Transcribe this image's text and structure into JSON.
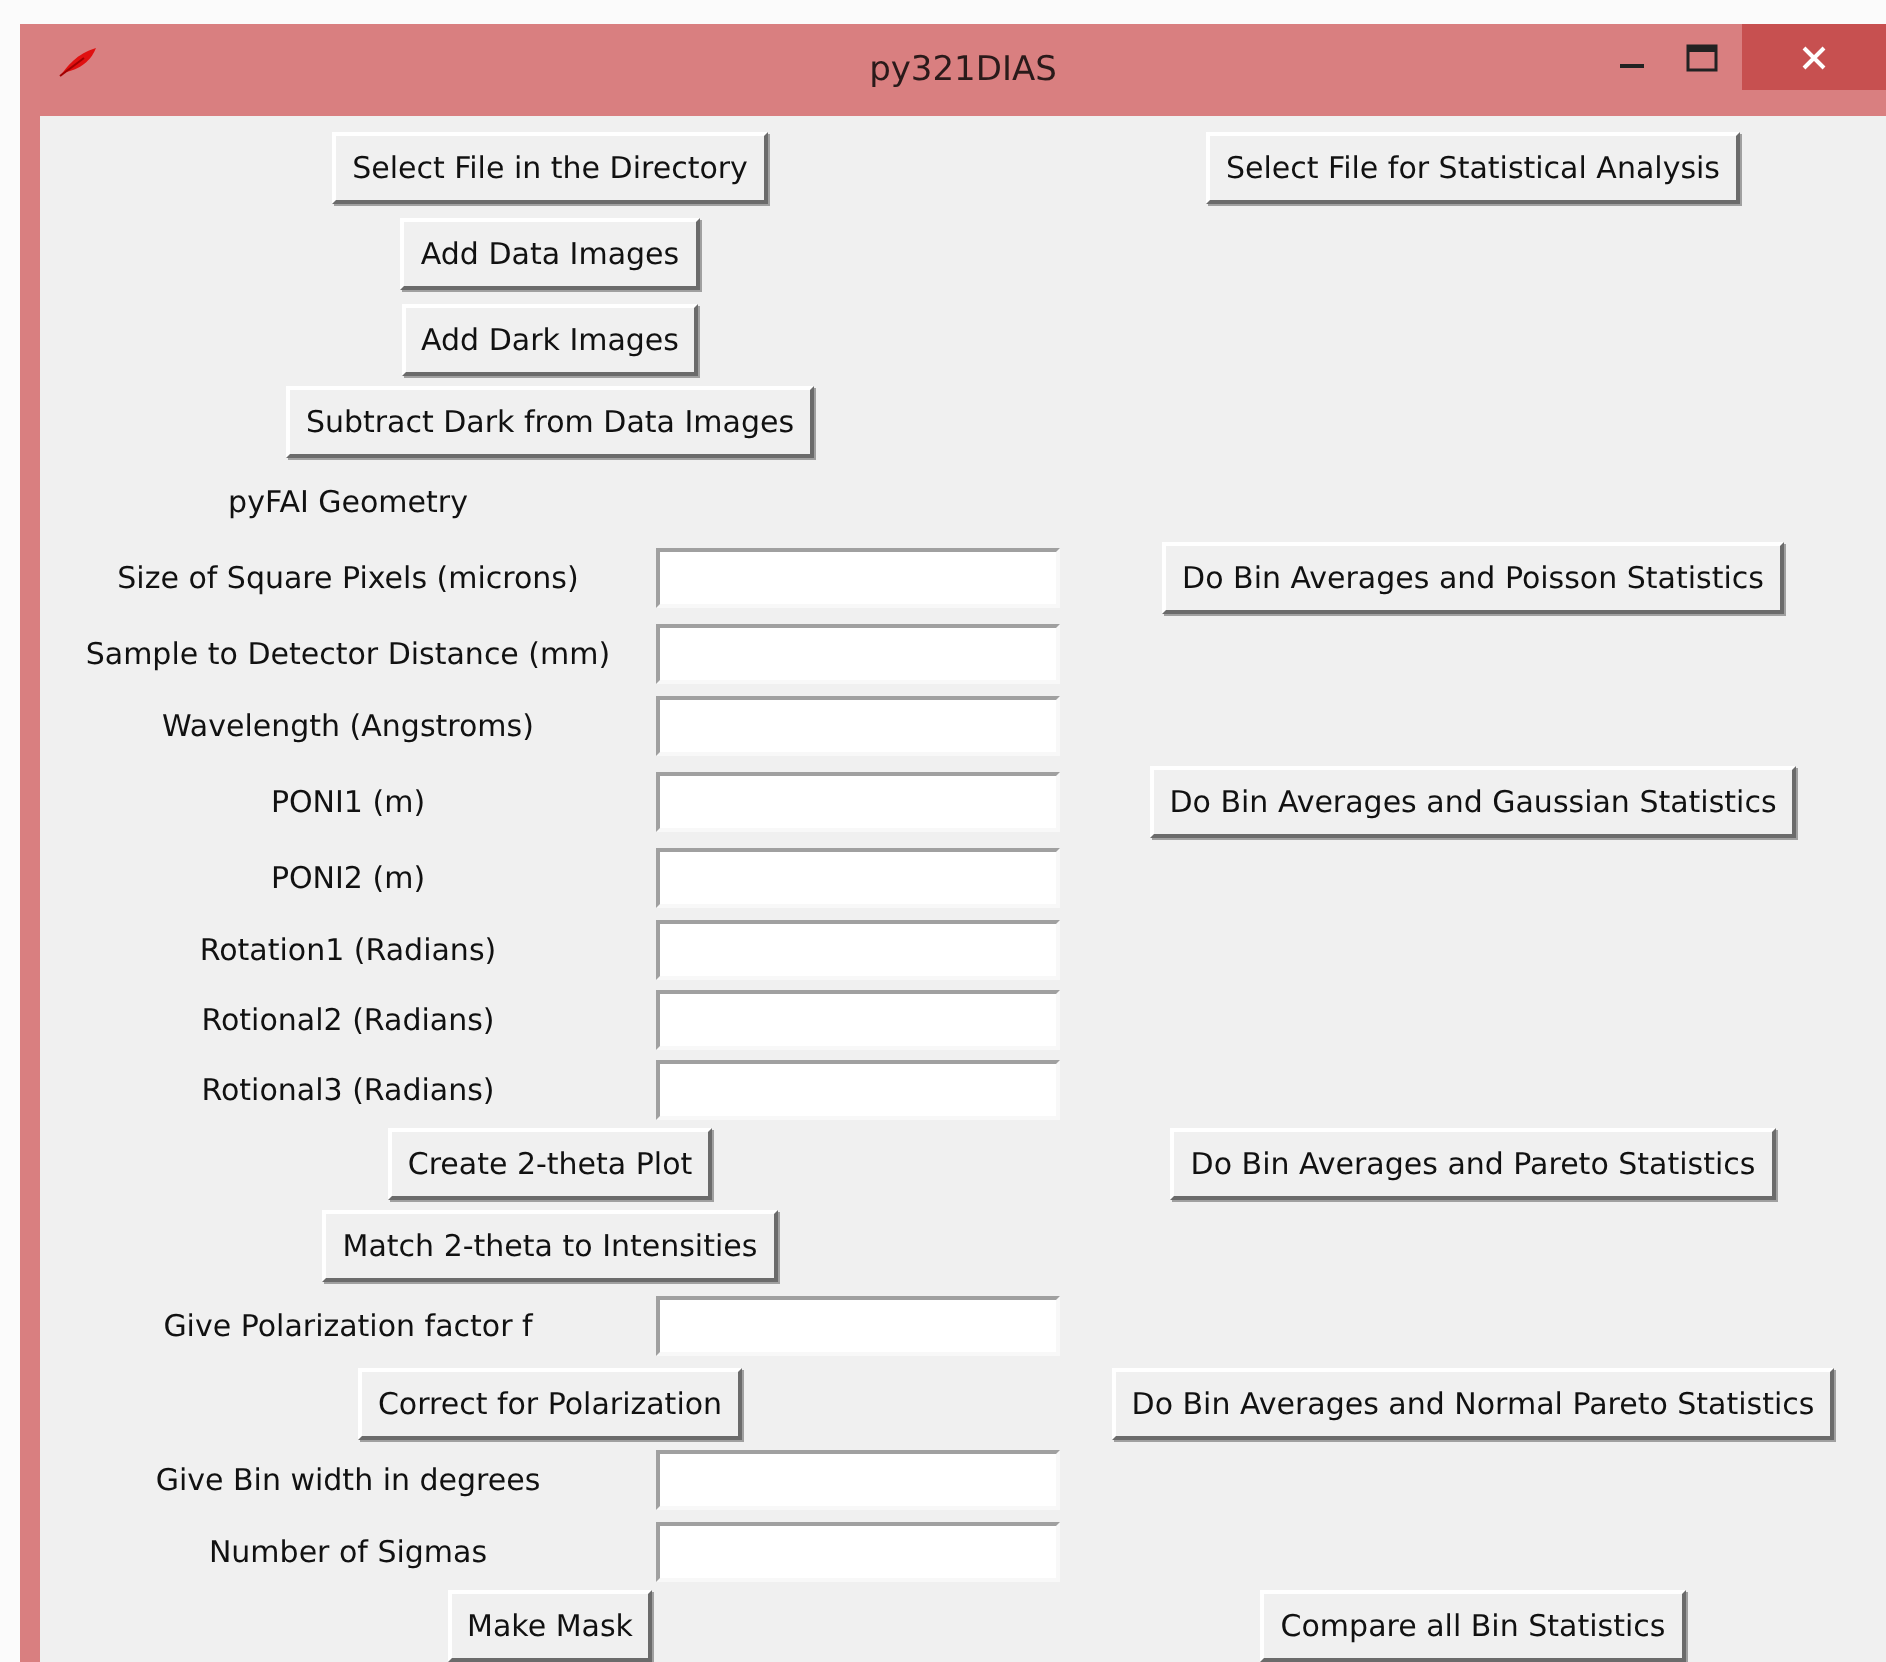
{
  "window": {
    "title": "py321DIAS"
  },
  "rows": [
    {
      "left": {
        "kind": "button",
        "label": "Select File in the Directory"
      },
      "right_button": "Select File for Statistical Analysis"
    },
    {
      "left": {
        "kind": "button",
        "label": "Add Data Images"
      }
    },
    {
      "left": {
        "kind": "button",
        "label": "Add Dark Images"
      }
    },
    {
      "left": {
        "kind": "button",
        "label": "Subtract Dark from Data Images"
      }
    },
    {
      "left": {
        "kind": "label",
        "label": "pyFAI Geometry"
      }
    },
    {
      "left": {
        "kind": "field",
        "label": "Size of Square Pixels (microns)"
      },
      "right_button": "Do Bin Averages and Poisson Statistics"
    },
    {
      "left": {
        "kind": "field",
        "label": "Sample to Detector Distance (mm)"
      }
    },
    {
      "left": {
        "kind": "field",
        "label": "Wavelength (Angstroms)"
      }
    },
    {
      "left": {
        "kind": "field",
        "label": "PONI1 (m)"
      },
      "right_button": "Do Bin Averages and Gaussian Statistics"
    },
    {
      "left": {
        "kind": "field",
        "label": "PONI2 (m)"
      }
    },
    {
      "left": {
        "kind": "field",
        "label": "Rotation1 (Radians)"
      }
    },
    {
      "left": {
        "kind": "field",
        "label": "Rotional2 (Radians)"
      }
    },
    {
      "left": {
        "kind": "field",
        "label": "Rotional3 (Radians)"
      }
    },
    {
      "left": {
        "kind": "button",
        "label": "Create 2-theta Plot"
      },
      "right_button": "Do Bin Averages and Pareto Statistics"
    },
    {
      "left": {
        "kind": "button",
        "label": "Match 2-theta to Intensities"
      }
    },
    {
      "left": {
        "kind": "field",
        "label": "Give Polarization factor f"
      }
    },
    {
      "left": {
        "kind": "button",
        "label": "Correct for Polarization"
      },
      "right_button": "Do Bin Averages and Normal Pareto Statistics"
    },
    {
      "left": {
        "kind": "field",
        "label": "Give Bin width in degrees"
      }
    },
    {
      "left": {
        "kind": "field",
        "label": "Number of Sigmas"
      }
    },
    {
      "left": {
        "kind": "button",
        "label": "Make Mask"
      },
      "right_button": "Compare all Bin Statistics"
    }
  ]
}
